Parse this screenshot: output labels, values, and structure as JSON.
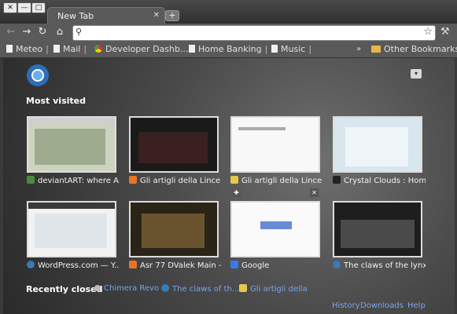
{
  "window_buttons": {
    "close": "✕",
    "minimize": "—",
    "maximize": "□"
  },
  "tab": {
    "title": "New Tab",
    "close": "✕",
    "new_tab": "+"
  },
  "toolbar": {
    "back": "←",
    "forward": "→",
    "reload": "↻",
    "home": "⌂",
    "address_value": "",
    "star": "☆",
    "wrench": "🔧"
  },
  "bookmarks": [
    {
      "label": "Meteo",
      "sep": "|"
    },
    {
      "label": "Mail",
      "sep": "|"
    },
    {
      "label": "Developer Dashb...",
      "sep": ""
    },
    {
      "label": "Home Banking",
      "sep": "|"
    },
    {
      "label": "Music",
      "sep": "|"
    }
  ],
  "other_bookmarks": "Other Bookmarks",
  "overflow_chevron": "»",
  "menu_button": "▾",
  "most_visited_heading": "Most visited",
  "most_visited": [
    {
      "title": "deviantART: where A...",
      "favicon_color": "#4b8a3c"
    },
    {
      "title": "Gli artigli della Lince",
      "favicon_color": "#e8742a"
    },
    {
      "title": "Gli artigli della Lince ...",
      "favicon_color": "#e8c84a"
    },
    {
      "title": "Crystal Clouds : Hom...",
      "favicon_color": "#222222"
    },
    {
      "title": "WordPress.com — Y...",
      "favicon_color": "#3a7ab8"
    },
    {
      "title": "Asr 77 DValek Main -...",
      "favicon_color": "#e8742a"
    },
    {
      "title": "Google",
      "favicon_color": "#3a7ae8"
    },
    {
      "title": "The claws of the lynx",
      "favicon_color": "#3a7ab8"
    }
  ],
  "thumbnail_controls": {
    "pin": "✚",
    "close": "✕"
  },
  "recently_closed_heading": "Recently closed",
  "recently_closed": [
    {
      "title": "Chimera Revo"
    },
    {
      "title": "The claws of th..."
    },
    {
      "title": "Gli artigli della"
    }
  ],
  "footer": {
    "history": "History",
    "downloads": "Downloads",
    "help": "Help"
  }
}
